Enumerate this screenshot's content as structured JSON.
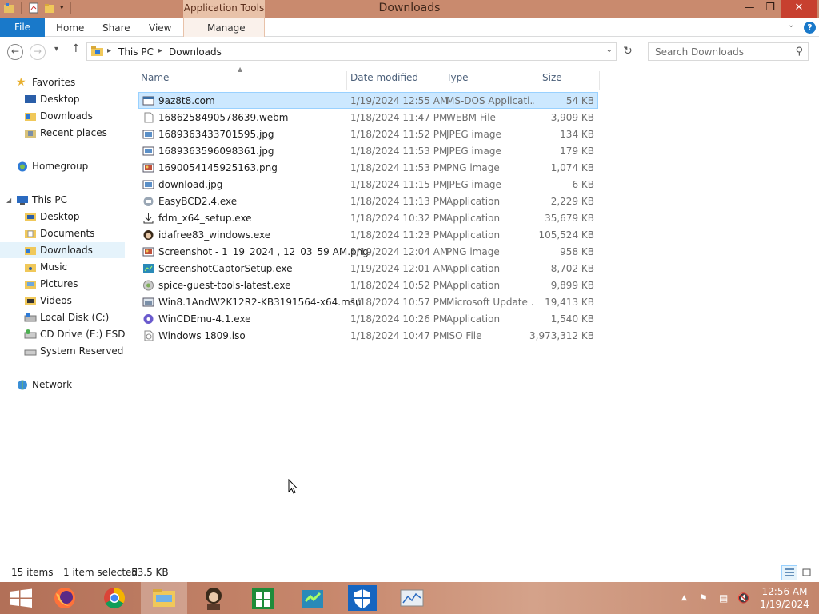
{
  "window": {
    "title": "Downloads",
    "contextual_tab": "Application Tools"
  },
  "ribbon": {
    "tabs": [
      "File",
      "Home",
      "Share",
      "View",
      "Manage"
    ]
  },
  "address": {
    "crumbs": [
      "This PC",
      "Downloads"
    ],
    "search_placeholder": "Search Downloads"
  },
  "nav": {
    "favorites": "Favorites",
    "fav_items": [
      "Desktop",
      "Downloads",
      "Recent places"
    ],
    "homegroup": "Homegroup",
    "thispc": "This PC",
    "pc_items": [
      "Desktop",
      "Documents",
      "Downloads",
      "Music",
      "Pictures",
      "Videos",
      "Local Disk (C:)",
      "CD Drive (E:) ESD-ISO",
      "System Reserved (F:)"
    ],
    "network": "Network"
  },
  "columns": {
    "name": "Name",
    "date": "Date modified",
    "type": "Type",
    "size": "Size"
  },
  "files": [
    {
      "name": "9az8t8.com",
      "date": "1/19/2024 12:55 AM",
      "type": "MS-DOS Applicati...",
      "size": "54 KB"
    },
    {
      "name": "1686258490578639.webm",
      "date": "1/18/2024 11:47 PM",
      "type": "WEBM File",
      "size": "3,909 KB"
    },
    {
      "name": "1689363433701595.jpg",
      "date": "1/18/2024 11:52 PM",
      "type": "JPEG image",
      "size": "134 KB"
    },
    {
      "name": "1689363596098361.jpg",
      "date": "1/18/2024 11:53 PM",
      "type": "JPEG image",
      "size": "179 KB"
    },
    {
      "name": "1690054145925163.png",
      "date": "1/18/2024 11:53 PM",
      "type": "PNG image",
      "size": "1,074 KB"
    },
    {
      "name": "download.jpg",
      "date": "1/18/2024 11:15 PM",
      "type": "JPEG image",
      "size": "6 KB"
    },
    {
      "name": "EasyBCD2.4.exe",
      "date": "1/18/2024 11:13 PM",
      "type": "Application",
      "size": "2,229 KB"
    },
    {
      "name": "fdm_x64_setup.exe",
      "date": "1/18/2024 10:32 PM",
      "type": "Application",
      "size": "35,679 KB"
    },
    {
      "name": "idafree83_windows.exe",
      "date": "1/18/2024 11:23 PM",
      "type": "Application",
      "size": "105,524 KB"
    },
    {
      "name": "Screenshot - 1_19_2024 , 12_03_59 AM.png",
      "date": "1/19/2024 12:04 AM",
      "type": "PNG image",
      "size": "958 KB"
    },
    {
      "name": "ScreenshotCaptorSetup.exe",
      "date": "1/19/2024 12:01 AM",
      "type": "Application",
      "size": "8,702 KB"
    },
    {
      "name": "spice-guest-tools-latest.exe",
      "date": "1/18/2024 10:52 PM",
      "type": "Application",
      "size": "9,899 KB"
    },
    {
      "name": "Win8.1AndW2K12R2-KB3191564-x64.msu",
      "date": "1/18/2024 10:57 PM",
      "type": "Microsoft Update ...",
      "size": "19,413 KB"
    },
    {
      "name": "WinCDEmu-4.1.exe",
      "date": "1/18/2024 10:26 PM",
      "type": "Application",
      "size": "1,540 KB"
    },
    {
      "name": "Windows 1809.iso",
      "date": "1/18/2024 10:47 PM",
      "type": "ISO File",
      "size": "3,973,312 KB"
    }
  ],
  "status": {
    "count": "15 items",
    "selected": "1 item selected",
    "selsize": "53.5 KB"
  },
  "clock": {
    "time": "12:56 AM",
    "date": "1/19/2024"
  },
  "colors": {
    "accent": "#1979ca",
    "titlebar": "#c98a6e",
    "selection": "#cce8ff"
  }
}
